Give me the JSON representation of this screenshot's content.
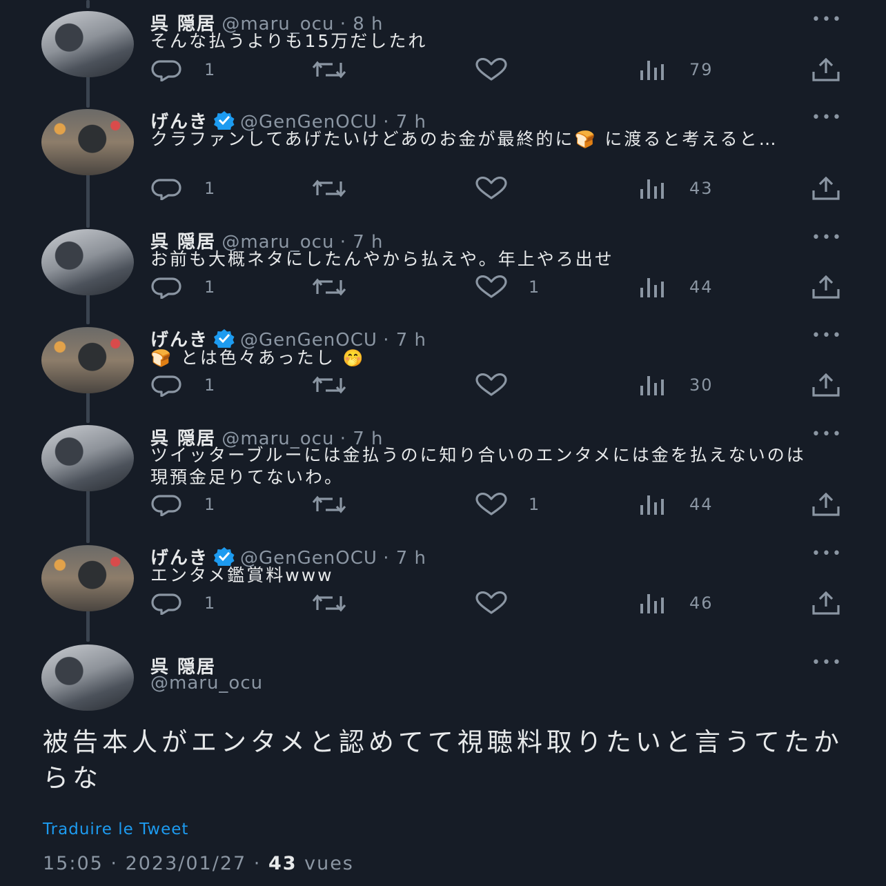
{
  "colors": {
    "background": "#161c26",
    "text": "#e7e9ea",
    "muted": "#8b96a3",
    "link": "#1d9bf0",
    "verified": "#1d9bf0"
  },
  "more_label": "•••",
  "tweets": [
    {
      "name": "呉 隠居",
      "handle": "@maru_ocu",
      "time": "· 8 h",
      "text": "そんな払うよりも15万だしたれ",
      "replies": "1",
      "retweets": "",
      "likes": "",
      "views": "79",
      "verified": false,
      "avatar": "maru"
    },
    {
      "name": "げんき",
      "handle": "@GenGenOCU",
      "time": "· 7 h",
      "text_parts": [
        "クラファンしてあげたいけどあのお金が最終的に",
        "🍞",
        "に渡ると考えると…"
      ],
      "replies": "1",
      "retweets": "",
      "likes": "",
      "views": "43",
      "verified": true,
      "avatar": "genki"
    },
    {
      "name": "呉 隠居",
      "handle": "@maru_ocu",
      "time": "· 7 h",
      "text": "お前も大概ネタにしたんやから払えや。年上やろ出せ",
      "replies": "1",
      "retweets": "",
      "likes": "1",
      "views": "44",
      "verified": false,
      "avatar": "maru"
    },
    {
      "name": "げんき",
      "handle": "@GenGenOCU",
      "time": "· 7 h",
      "text_parts": [
        "🍞",
        "とは色々あったし",
        "🤭"
      ],
      "replies": "1",
      "retweets": "",
      "likes": "",
      "views": "30",
      "verified": true,
      "avatar": "genki"
    },
    {
      "name": "呉 隠居",
      "handle": "@maru_ocu",
      "time": "· 7 h",
      "text": "ツイッターブルーには金払うのに知り合いのエンタメには金を払えないのは現預金足りてないわ。",
      "replies": "1",
      "retweets": "",
      "likes": "1",
      "views": "44",
      "verified": false,
      "avatar": "maru"
    },
    {
      "name": "げんき",
      "handle": "@GenGenOCU",
      "time": "· 7 h",
      "text": "エンタメ鑑賞料www",
      "replies": "1",
      "retweets": "",
      "likes": "",
      "views": "46",
      "verified": true,
      "avatar": "genki"
    }
  ],
  "main_tweet": {
    "name": "呉 隠居",
    "handle": "@maru_ocu",
    "text": "被告本人がエンタメと認めてて視聴料取りたいと言うてたからな",
    "translate_label": "Traduire le Tweet",
    "time": "15:05",
    "date": "2023/01/27",
    "views_count": "43",
    "views_label": "vues"
  }
}
